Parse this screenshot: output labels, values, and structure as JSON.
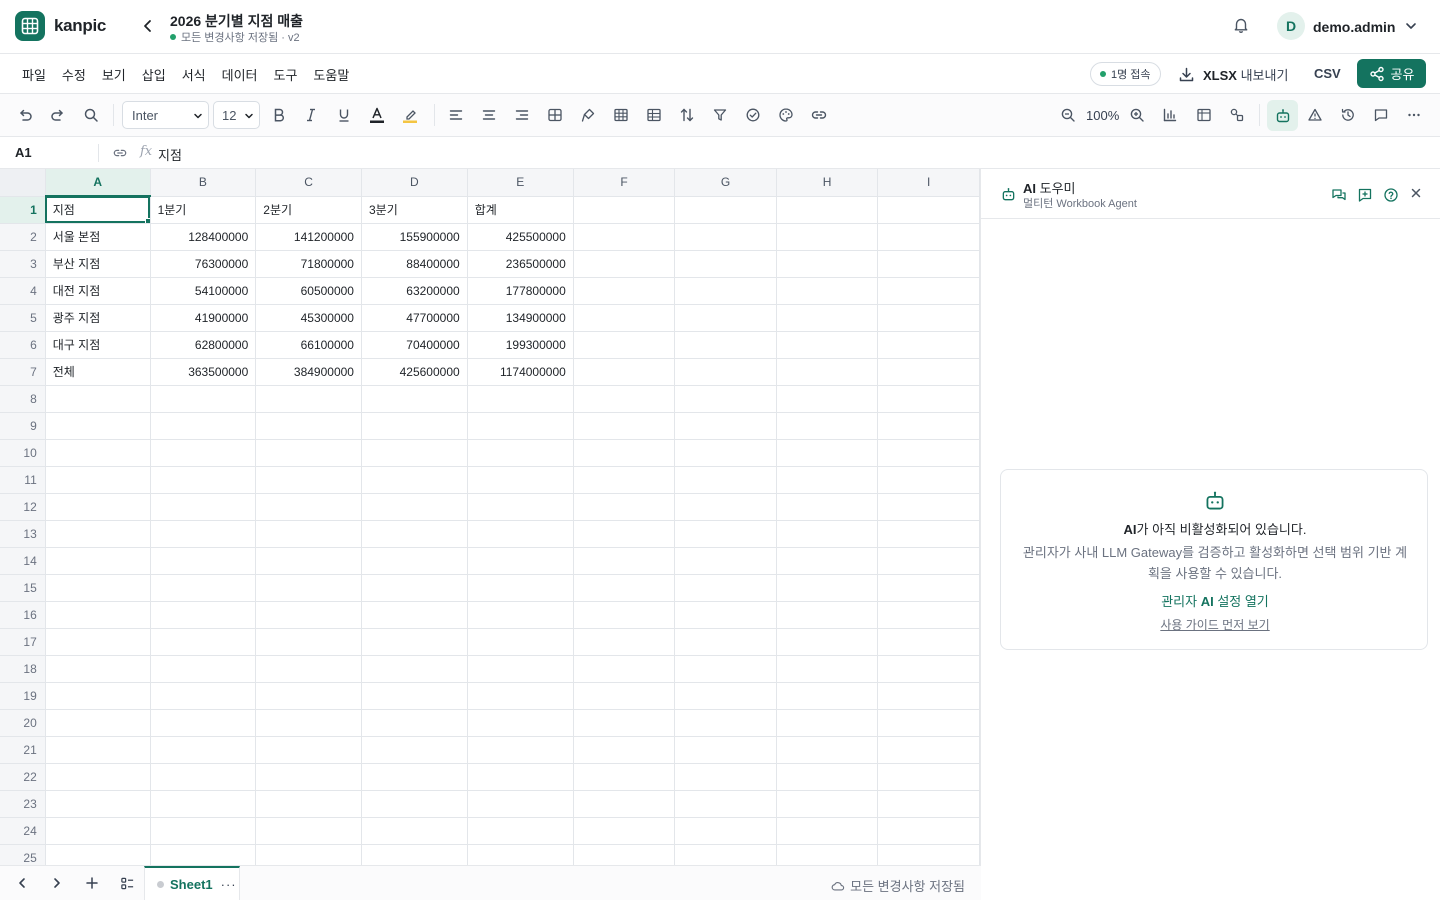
{
  "app": {
    "name": "kanpic"
  },
  "document": {
    "title": "2026 분기별 지점 매출",
    "status": "모든 변경사항 저장됨 · v2"
  },
  "user": {
    "avatar_initial": "D",
    "name": "demo.admin"
  },
  "menu": [
    "파일",
    "수정",
    "보기",
    "삽입",
    "서식",
    "데이터",
    "도구",
    "도움말"
  ],
  "presence": {
    "label": "1명 접속"
  },
  "export": {
    "xlsx_bold": "XLSX",
    "xlsx_rest": " 내보내기",
    "csv": "CSV"
  },
  "share": {
    "label": "공유"
  },
  "toolbar": {
    "font": "Inter",
    "size": "12",
    "zoom": "100%"
  },
  "formula": {
    "cell_ref": "A1",
    "fx": "fx",
    "value": "지점"
  },
  "grid": {
    "columns": [
      "A",
      "B",
      "C",
      "D",
      "E",
      "F",
      "G",
      "H",
      "I"
    ],
    "rows": [
      [
        "지점",
        "1분기",
        "2분기",
        "3분기",
        "합계",
        "",
        "",
        "",
        ""
      ],
      [
        "서울 본점",
        "128400000",
        "141200000",
        "155900000",
        "425500000",
        "",
        "",
        "",
        ""
      ],
      [
        "부산 지점",
        "76300000",
        "71800000",
        "88400000",
        "236500000",
        "",
        "",
        "",
        ""
      ],
      [
        "대전 지점",
        "54100000",
        "60500000",
        "63200000",
        "177800000",
        "",
        "",
        "",
        ""
      ],
      [
        "광주 지점",
        "41900000",
        "45300000",
        "47700000",
        "134900000",
        "",
        "",
        "",
        ""
      ],
      [
        "대구 지점",
        "62800000",
        "66100000",
        "70400000",
        "199300000",
        "",
        "",
        "",
        ""
      ],
      [
        "전체",
        "363500000",
        "384900000",
        "425600000",
        "1174000000",
        "",
        "",
        "",
        ""
      ],
      [
        "",
        "",
        "",
        "",
        "",
        "",
        "",
        "",
        ""
      ],
      [
        "",
        "",
        "",
        "",
        "",
        "",
        "",
        "",
        ""
      ],
      [
        "",
        "",
        "",
        "",
        "",
        "",
        "",
        "",
        ""
      ],
      [
        "",
        "",
        "",
        "",
        "",
        "",
        "",
        "",
        ""
      ],
      [
        "",
        "",
        "",
        "",
        "",
        "",
        "",
        "",
        ""
      ],
      [
        "",
        "",
        "",
        "",
        "",
        "",
        "",
        "",
        ""
      ],
      [
        "",
        "",
        "",
        "",
        "",
        "",
        "",
        "",
        ""
      ],
      [
        "",
        "",
        "",
        "",
        "",
        "",
        "",
        "",
        ""
      ],
      [
        "",
        "",
        "",
        "",
        "",
        "",
        "",
        "",
        ""
      ],
      [
        "",
        "",
        "",
        "",
        "",
        "",
        "",
        "",
        ""
      ],
      [
        "",
        "",
        "",
        "",
        "",
        "",
        "",
        "",
        ""
      ],
      [
        "",
        "",
        "",
        "",
        "",
        "",
        "",
        "",
        ""
      ],
      [
        "",
        "",
        "",
        "",
        "",
        "",
        "",
        "",
        ""
      ],
      [
        "",
        "",
        "",
        "",
        "",
        "",
        "",
        "",
        ""
      ],
      [
        "",
        "",
        "",
        "",
        "",
        "",
        "",
        "",
        ""
      ],
      [
        "",
        "",
        "",
        "",
        "",
        "",
        "",
        "",
        ""
      ],
      [
        "",
        "",
        "",
        "",
        "",
        "",
        "",
        "",
        ""
      ],
      [
        "",
        "",
        "",
        "",
        "",
        "",
        "",
        "",
        ""
      ]
    ]
  },
  "sheets": {
    "active": "Sheet1",
    "more": "···"
  },
  "save_status": "모든 변경사항 저장됨",
  "ai_panel": {
    "title_bold": "AI",
    "title_rest": " 도우미",
    "subtitle": "멀티턴 Workbook Agent",
    "card_title_bold": "AI",
    "card_title_rest": "가 아직 비활성화되어 있습니다.",
    "card_desc": "관리자가 사내 LLM Gateway를 검증하고 활성화하면 선택 범위 기반 계획을 사용할 수 있습니다.",
    "card_link_pre": "관리자 ",
    "card_link_bold": "AI",
    "card_link_post": " 설정 열기",
    "card_guide": "사용 가이드 먼저 보기"
  },
  "colors": {
    "brand": "#14735f",
    "brand_light": "#e3f1ec",
    "online": "#22a06b"
  }
}
